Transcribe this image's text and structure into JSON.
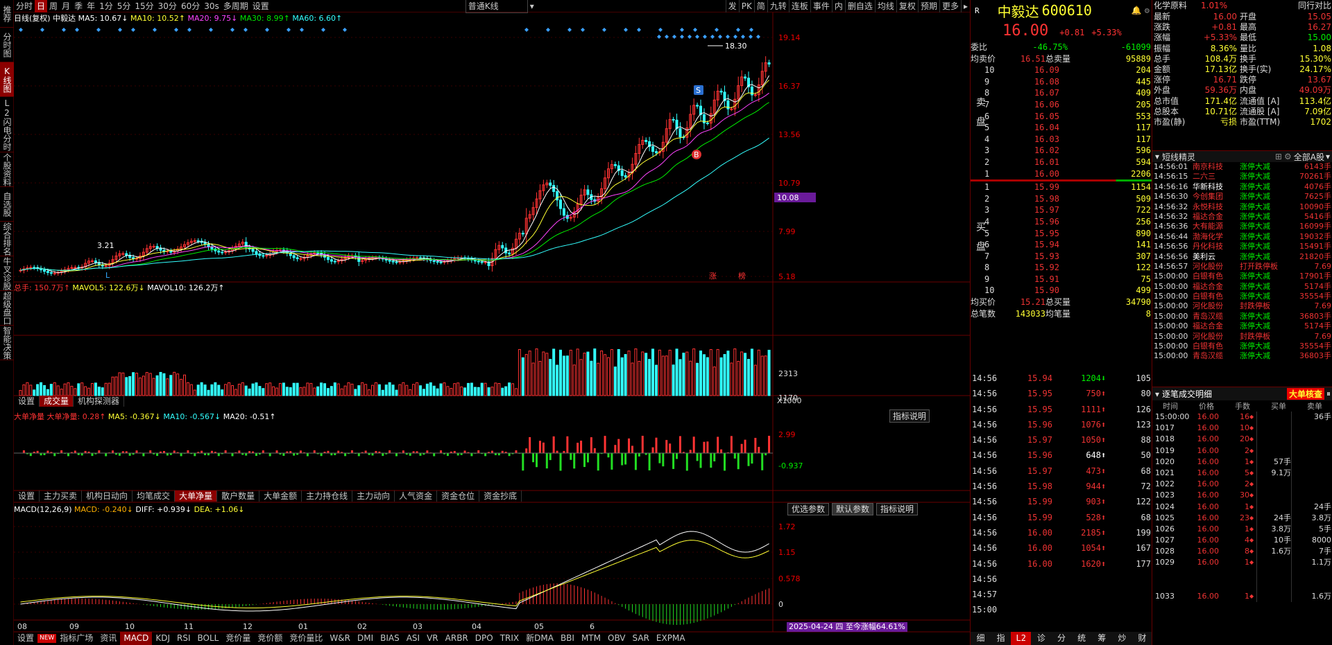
{
  "side_tabs": [
    "推荐",
    "分时图",
    "K线图",
    "L2闪电分时",
    "个股资料",
    "自选股",
    "综合排名",
    "牛叉诊股",
    "超级盘口",
    "智能决策"
  ],
  "topbar": {
    "items": [
      "分时",
      "日",
      "周",
      "月",
      "季",
      "年",
      "1分",
      "5分",
      "15分",
      "30分",
      "60分",
      "30s",
      "多周期",
      "设置"
    ],
    "kline_type": "普通K线",
    "right": [
      "发",
      "PK",
      "简",
      "九转",
      "连板",
      "事件",
      "内",
      "删自选",
      "均线",
      "复权",
      "预期",
      "更多"
    ]
  },
  "main_legend": {
    "name": "日线(复权)",
    "stock": "中毅达",
    "ma5": "MA5: 10.67↓",
    "ma10": "MA10: 10.52↑",
    "ma20": "MA20: 9.75↓",
    "ma30": "MA30: 8.99↑",
    "ma60": "MA60: 6.60↑"
  },
  "price_axis": [
    "19.14",
    "16.37",
    "13.56",
    "10.79",
    "7.99",
    "5.18"
  ],
  "price_tag": "10.08",
  "high_label": "18.30",
  "low_label": "3.21",
  "low_mark": "L",
  "zhang_mark": "涨",
  "bang_mark": "榜",
  "s_mark": "S",
  "b_mark": "B",
  "vol_legend": {
    "a": "总手: 150.7万↑",
    "b": "MAVOL5: 122.6万↓",
    "c": "MAVOL10: 126.2万↑"
  },
  "vol_axis": [
    "2313",
    "1170",
    "X1000"
  ],
  "mid_tabs": [
    "设置",
    "成交量",
    "机构探测器"
  ],
  "big_legend": {
    "a": "大单净量",
    "b": "大单净量: 0.28↑",
    "c": "MA5: -0.367↓",
    "d": "MA10: -0.567↓",
    "e": "MA20: -0.51↑"
  },
  "big_axis": [
    "2.99",
    "-0.937"
  ],
  "indicator_btn": "指标说明",
  "ind_tabs": [
    "设置",
    "主力买卖",
    "机构日动向",
    "均笔成交",
    "大单净量",
    "散户数量",
    "大单金额",
    "主力持仓线",
    "主力动向",
    "人气资金",
    "资金仓位",
    "资金抄底"
  ],
  "macd_legend": {
    "a": "MACD(12,26,9)",
    "b": "MACD: -0.240↓",
    "c": "DIFF: +0.939↓",
    "d": "DEA: +1.06↓"
  },
  "macd_btns": [
    "优选参数",
    "默认参数",
    "指标说明"
  ],
  "macd_axis": [
    "1.72",
    "1.15",
    "0.578",
    "0"
  ],
  "date_axis": [
    "08",
    "09",
    "10",
    "11",
    "12",
    "01",
    "02",
    "03",
    "04",
    "05",
    "6"
  ],
  "date_banner": "2025-04-24 四 至今涨幅64.61%",
  "bottom_tabs": [
    "设置",
    "NEW",
    "指标广场",
    "资讯",
    "MACD",
    "KDJ",
    "RSI",
    "BOLL",
    "竞价量",
    "竞价额",
    "竞价量比",
    "W&R",
    "DMI",
    "BIAS",
    "ASI",
    "VR",
    "ARBR",
    "DPO",
    "TRIX",
    "新DMA",
    "BBI",
    "MTM",
    "OBV",
    "SAR",
    "EXPMA"
  ],
  "stock": {
    "r": "R",
    "name": "中毅达",
    "code": "600610",
    "price": "16.00",
    "chg": "+0.81",
    "pct": "+5.33%"
  },
  "weibi": {
    "label": "委比",
    "pct": "-46.75%",
    "val": "-61099"
  },
  "avg_sell": {
    "l": "均卖价",
    "p": "16.51",
    "l2": "总卖量",
    "v": "95889"
  },
  "sell": [
    [
      "10",
      "16.09",
      "204"
    ],
    [
      "9",
      "16.08",
      "445"
    ],
    [
      "8",
      "16.07",
      "409"
    ],
    [
      "7",
      "16.06",
      "205"
    ],
    [
      "6",
      "16.05",
      "553"
    ],
    [
      "5",
      "16.04",
      "117"
    ],
    [
      "4",
      "16.03",
      "117"
    ],
    [
      "3",
      "16.02",
      "596"
    ],
    [
      "2",
      "16.01",
      "594"
    ],
    [
      "1",
      "16.00",
      "2206"
    ]
  ],
  "buy": [
    [
      "1",
      "15.99",
      "1154"
    ],
    [
      "2",
      "15.98",
      "509"
    ],
    [
      "3",
      "15.97",
      "722"
    ],
    [
      "4",
      "15.96",
      "256"
    ],
    [
      "5",
      "15.95",
      "890"
    ],
    [
      "6",
      "15.94",
      "141"
    ],
    [
      "7",
      "15.93",
      "307"
    ],
    [
      "8",
      "15.92",
      "122"
    ],
    [
      "9",
      "15.91",
      "75"
    ],
    [
      "10",
      "15.90",
      "499"
    ]
  ],
  "sell_lbl": "卖盘",
  "buy_lbl": "买盘",
  "avg_buy": {
    "l": "均买价",
    "p": "15.21",
    "l2": "总买量",
    "v": "34790"
  },
  "total_trades": {
    "l": "总笔数",
    "p": "143033",
    "l2": "均笔量",
    "v": "8"
  },
  "ticks": [
    [
      "14:56",
      "15.94",
      "1204",
      "105",
      "g"
    ],
    [
      "14:56",
      "15.95",
      "750",
      "80",
      "r"
    ],
    [
      "14:56",
      "15.95",
      "1111",
      "126",
      "r"
    ],
    [
      "14:56",
      "15.96",
      "1076",
      "123",
      "r"
    ],
    [
      "14:56",
      "15.97",
      "1050",
      "88",
      "r"
    ],
    [
      "14:56",
      "15.96",
      "648",
      "50",
      "w"
    ],
    [
      "14:56",
      "15.97",
      "473",
      "68",
      "r"
    ],
    [
      "14:56",
      "15.98",
      "944",
      "72",
      "r"
    ],
    [
      "14:56",
      "15.99",
      "903",
      "122",
      "r"
    ],
    [
      "14:56",
      "15.99",
      "528",
      "68",
      "r"
    ],
    [
      "14:56",
      "16.00",
      "2185",
      "199",
      "r"
    ],
    [
      "14:56",
      "16.00",
      "1054",
      "167",
      "r"
    ],
    [
      "14:56",
      "16.00",
      "1620",
      "177",
      "r"
    ],
    [
      "14:56",
      "",
      "",
      "",
      ""
    ],
    [
      "14:57",
      "",
      "",
      "",
      ""
    ],
    [
      "15:00",
      "",
      "",
      "",
      ""
    ]
  ],
  "rp_bottom": [
    "细",
    "指",
    "L2",
    "诊",
    "分",
    "统",
    "筹",
    "炒",
    "财"
  ],
  "far_top": {
    "a": "化学原料",
    "b": "1.01%",
    "c": "同行对比"
  },
  "quote": [
    [
      "最新",
      "16.00",
      "开盘",
      "15.05"
    ],
    [
      "涨跌",
      "+0.81",
      "最高",
      "16.27"
    ],
    [
      "涨幅",
      "+5.33%",
      "最低",
      "15.00"
    ],
    [
      "振幅",
      "8.36%",
      "量比",
      "1.08"
    ],
    [
      "总手",
      "108.4万",
      "换手",
      "15.30%"
    ],
    [
      "金额",
      "17.13亿",
      "换手(实)",
      "24.17%"
    ],
    [
      "涨停",
      "16.71",
      "跌停",
      "13.67"
    ],
    [
      "外盘",
      "59.36万",
      "内盘",
      "49.09万"
    ],
    [
      "总市值",
      "171.4亿",
      "流通值 [A]",
      "113.4亿"
    ],
    [
      "总股本",
      "10.71亿",
      "流通股 [A]",
      "7.09亿"
    ],
    [
      "市盈(静)",
      "亏损",
      "市盈(TTM)",
      "1702"
    ]
  ],
  "short": {
    "title": "短线精灵",
    "filter": "全部A股"
  },
  "hot": [
    [
      "14:56:01",
      "南京科技",
      "涨停大减",
      "6143手"
    ],
    [
      "14:56:15",
      "二六三",
      "涨停大减",
      "70261手"
    ],
    [
      "14:56:16",
      "华新科技",
      "涨停大减",
      "4076手"
    ],
    [
      "14:56:30",
      "今创集团",
      "涨停大减",
      "7625手"
    ],
    [
      "14:56:32",
      "永悦科技",
      "涨停大减",
      "10090手"
    ],
    [
      "14:56:32",
      "福达合金",
      "涨停大减",
      "5416手"
    ],
    [
      "14:56:36",
      "大有能源",
      "涨停大减",
      "16099手"
    ],
    [
      "14:56:44",
      "渤海化学",
      "涨停大减",
      "19032手"
    ],
    [
      "14:56:56",
      "丹化科技",
      "涨停大减",
      "15491手"
    ],
    [
      "14:56:56",
      "美利云",
      "涨停大减",
      "21820手"
    ],
    [
      "14:56:57",
      "河化股份",
      "打开跌停板",
      "7.69"
    ],
    [
      "15:00:00",
      "白银有色",
      "涨停大减",
      "17901手"
    ],
    [
      "15:00:00",
      "福达合金",
      "涨停大减",
      "5174手"
    ],
    [
      "15:00:00",
      "白银有色",
      "涨停大减",
      "35554手"
    ],
    [
      "15:00:00",
      "河化股份",
      "封跌停板",
      "7.69"
    ],
    [
      "15:00:00",
      "青岛汉缆",
      "涨停大减",
      "36803手"
    ],
    [
      "15:00:00",
      "福达合金",
      "涨停大减",
      "5174手"
    ],
    [
      "15:00:00",
      "河化股份",
      "封跌停板",
      "7.69"
    ],
    [
      "15:00:00",
      "白银有色",
      "涨停大减",
      "35554手"
    ],
    [
      "15:00:00",
      "青岛汉缆",
      "涨停大减",
      "36803手"
    ]
  ],
  "detail": {
    "title": "逐笔成交明细",
    "btn": "大单核查",
    "headers": [
      "时间",
      "价格",
      "手数",
      "买单",
      "卖单"
    ],
    "rows": [
      [
        "15:00:00",
        "16.00",
        "16",
        "",
        "36手"
      ],
      [
        "1017",
        "16.00",
        "10",
        "",
        ""
      ],
      [
        "1018",
        "16.00",
        "20",
        "",
        ""
      ],
      [
        "1019",
        "16.00",
        "2",
        "",
        ""
      ],
      [
        "1020",
        "16.00",
        "1",
        "57手",
        ""
      ],
      [
        "1021",
        "16.00",
        "5",
        "9.1万",
        ""
      ],
      [
        "1022",
        "16.00",
        "2",
        "",
        ""
      ],
      [
        "1023",
        "16.00",
        "30",
        "",
        ""
      ],
      [
        "1024",
        "16.00",
        "1",
        "",
        "24手"
      ],
      [
        "1025",
        "16.00",
        "23",
        "24手",
        "3.8万"
      ],
      [
        "1026",
        "16.00",
        "1",
        "3.8万",
        "5手"
      ],
      [
        "1027",
        "16.00",
        "4",
        "10手",
        "8000"
      ],
      [
        "1028",
        "16.00",
        "8",
        "1.6万",
        "7手"
      ],
      [
        "1029",
        "16.00",
        "1",
        "",
        "1.1万"
      ],
      [
        "",
        "",
        "",
        "",
        ""
      ],
      [
        "",
        "",
        "",
        "",
        ""
      ],
      [
        "1033",
        "16.00",
        "1",
        "",
        "1.6万"
      ]
    ]
  }
}
